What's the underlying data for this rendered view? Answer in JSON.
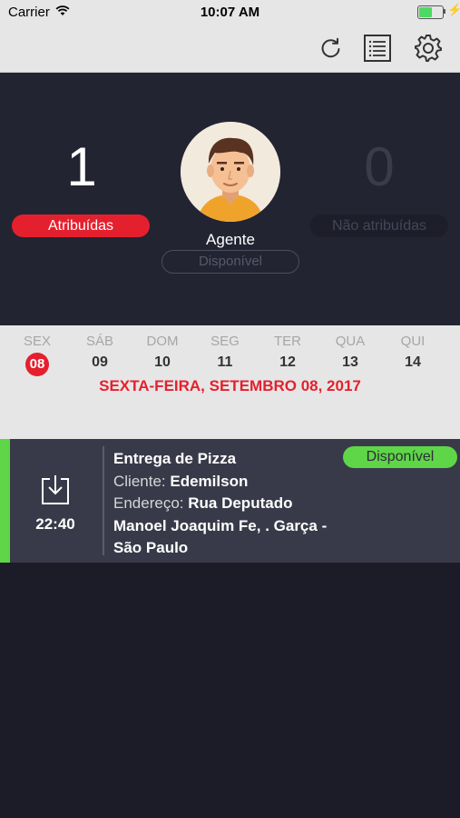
{
  "status_bar": {
    "carrier": "Carrier",
    "time": "10:07 AM",
    "battery_level": 0.55,
    "battery_color": "#4cd964"
  },
  "toolbar": {
    "icons": [
      "refresh-icon",
      "list-icon",
      "gear-icon"
    ]
  },
  "summary": {
    "assigned_count": "1",
    "assigned_label": "Atribuídas",
    "unassigned_count": "0",
    "unassigned_label": "Não atribuídas",
    "agent_name": "Agente",
    "agent_status": "Disponível",
    "accent_color": "#e5202e"
  },
  "calendar": {
    "days": [
      {
        "name": "SEX",
        "num": "08",
        "selected": true
      },
      {
        "name": "SÁB",
        "num": "09",
        "selected": false
      },
      {
        "name": "DOM",
        "num": "10",
        "selected": false
      },
      {
        "name": "SEG",
        "num": "11",
        "selected": false
      },
      {
        "name": "TER",
        "num": "12",
        "selected": false
      },
      {
        "name": "QUA",
        "num": "13",
        "selected": false
      },
      {
        "name": "QUI",
        "num": "14",
        "selected": false
      }
    ],
    "selected_date": "SEXTA-FEIRA, SETEMBRO 08, 2017"
  },
  "task": {
    "time": "22:40",
    "icon": "download-icon",
    "title": "Entrega de Pizza",
    "client_label": "Cliente:",
    "client_value": "Edemilson",
    "address_label": "Endereço:",
    "address_value": "Rua Deputado Manoel Joaquim Fe, . Garça - São Paulo",
    "status": "Disponível",
    "status_color": "#5fd548"
  }
}
